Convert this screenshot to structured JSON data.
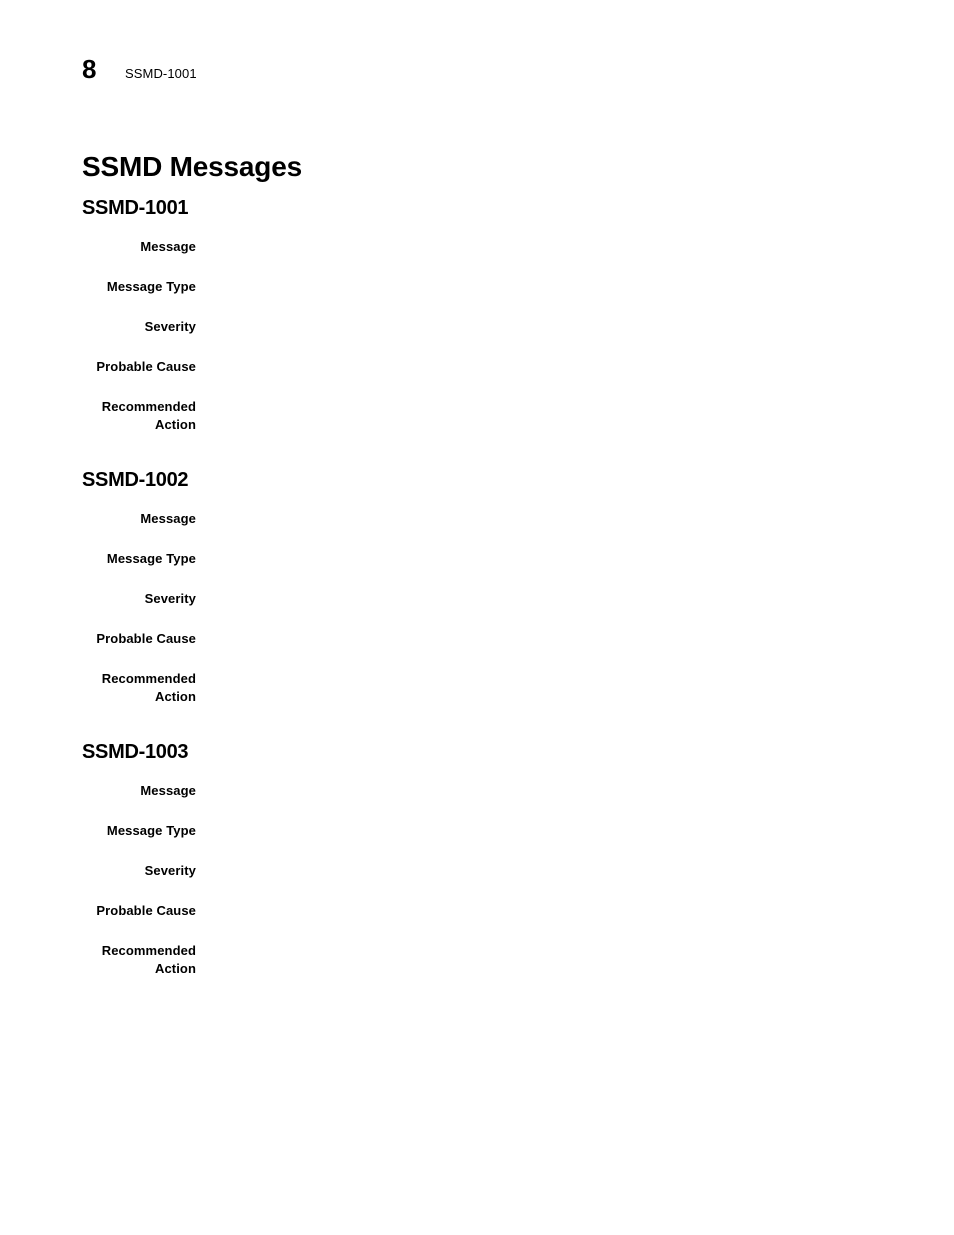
{
  "document": {
    "page_number": "8",
    "running_header_ref": "SSMD-1001",
    "chapter_title": "SSMD Messages",
    "text_color": "#000000",
    "background_color": "#ffffff"
  },
  "field_labels": {
    "message": "Message",
    "message_type": "Message Type",
    "severity": "Severity",
    "probable_cause": "Probable Cause",
    "recommended_action": "Recommended\nAction"
  },
  "sections": [
    {
      "heading": "SSMD-1001",
      "fields": [
        {
          "label": "Message",
          "value": ""
        },
        {
          "label": "Message Type",
          "value": ""
        },
        {
          "label": "Severity",
          "value": ""
        },
        {
          "label": "Probable Cause",
          "value": ""
        },
        {
          "label": "Recommended\nAction",
          "value": ""
        }
      ]
    },
    {
      "heading": "SSMD-1002",
      "fields": [
        {
          "label": "Message",
          "value": ""
        },
        {
          "label": "Message Type",
          "value": ""
        },
        {
          "label": "Severity",
          "value": ""
        },
        {
          "label": "Probable Cause",
          "value": ""
        },
        {
          "label": "Recommended\nAction",
          "value": ""
        }
      ]
    },
    {
      "heading": "SSMD-1003",
      "fields": [
        {
          "label": "Message",
          "value": ""
        },
        {
          "label": "Message Type",
          "value": ""
        },
        {
          "label": "Severity",
          "value": ""
        },
        {
          "label": "Probable Cause",
          "value": ""
        },
        {
          "label": "Recommended\nAction",
          "value": ""
        }
      ]
    }
  ]
}
